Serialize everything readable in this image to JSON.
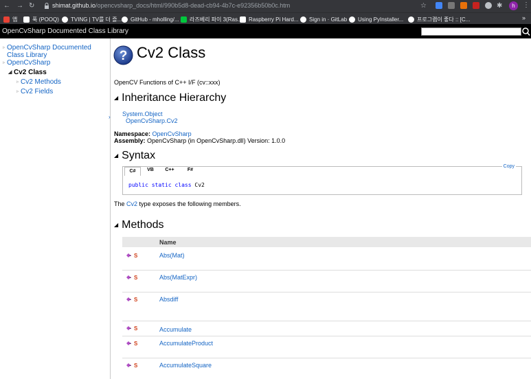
{
  "browser": {
    "url_host": "shimat.github.io",
    "url_path": "/opencvsharp_docs/html/990b5d8-dead-cb94-4b7c-e92356b50b0c.htm",
    "avatar_letter": "h",
    "bookmarks": [
      {
        "label": "앱",
        "color": "#e94235"
      },
      {
        "label": "푹 (POOQ)",
        "color": "#ffffff"
      },
      {
        "label": "TVING | TV를 더 즐...",
        "color": "#ffffff"
      },
      {
        "label": "GitHub - mholling/...",
        "color": "#ffffff"
      },
      {
        "label": "라즈베리 파이 3(Ras...",
        "color": "#00c73c"
      },
      {
        "label": "Raspberry Pi Hard...",
        "color": "#ffffff"
      },
      {
        "label": "Sign in · GitLab",
        "color": "#ffffff"
      },
      {
        "label": "Using PyInstaller...",
        "color": "#ffffff"
      },
      {
        "label": "프로그램이 좋다 :: [C...",
        "color": "#ffffff"
      }
    ],
    "more_label": "»"
  },
  "header": {
    "title": "OpenCvSharp Documented Class Library",
    "search_placeholder": ""
  },
  "sidebar": {
    "items": [
      {
        "label": "OpenCvSharp Documented Class Library"
      },
      {
        "label": "OpenCvSharp"
      },
      {
        "label": "Cv2 Class"
      },
      {
        "label": "Cv2 Methods"
      },
      {
        "label": "Cv2 Fields"
      }
    ]
  },
  "page": {
    "title": "Cv2 Class",
    "summary": "OpenCV Functions of C++ I/F (cv::xxx)",
    "inheritance_heading": "Inheritance Hierarchy",
    "hierarchy": [
      "System.Object",
      "OpenCvSharp.Cv2"
    ],
    "namespace_label": "Namespace:",
    "namespace_value": "OpenCvSharp",
    "assembly_label": "Assembly:",
    "assembly_value": "OpenCvSharp (in OpenCvSharp.dll) Version: 1.0.0",
    "syntax_heading": "Syntax",
    "syntax_tabs": [
      "C#",
      "VB",
      "C++",
      "F#"
    ],
    "copy_label": "Copy",
    "code": {
      "kw1": "public",
      "kw2": "static",
      "kw3": "class",
      "name": "Cv2"
    },
    "members_pre": "The ",
    "members_link": "Cv2",
    "members_post": " type exposes the following members.",
    "methods_heading": "Methods",
    "table_header": "Name",
    "methods": [
      "Abs(Mat)",
      "Abs(MatExpr)",
      "Absdiff",
      "Accumulate",
      "AccumulateProduct",
      "AccumulateSquare"
    ]
  },
  "colors": {
    "link": "#1364c4",
    "chrome": "#35363a",
    "header": "#000000",
    "keyword": "#0000ff"
  }
}
